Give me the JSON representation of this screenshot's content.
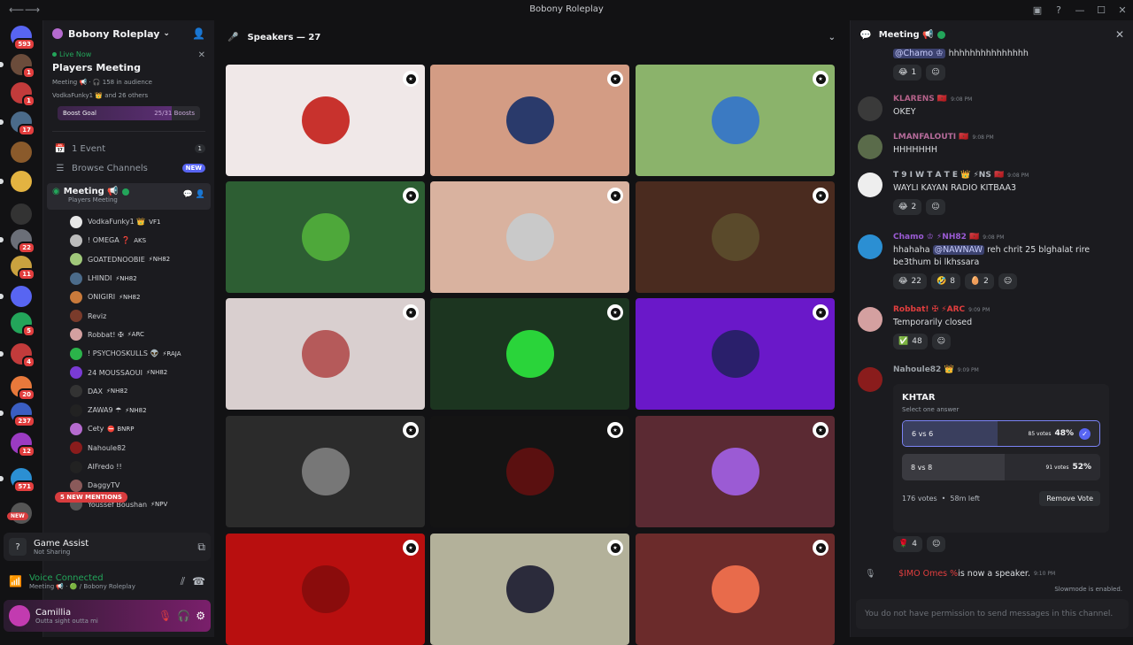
{
  "window": {
    "title": "Bobony Roleplay"
  },
  "guilds": [
    {
      "badge": "593",
      "color": "#5865f2"
    },
    {
      "badge": "1",
      "color": "#6b4c3b"
    },
    {
      "badge": "1",
      "color": "#c23b3b"
    },
    {
      "badge": "17",
      "color": "#4b6b8a"
    },
    {
      "badge": "",
      "color": "#8a5a2b"
    },
    {
      "badge": "",
      "color": "#e3b341"
    },
    {
      "badge": "",
      "color": "#333"
    },
    {
      "badge": "22",
      "color": "#6b6f78"
    },
    {
      "badge": "11",
      "color": "#caa23f"
    },
    {
      "badge": "",
      "color": "#5865f2"
    },
    {
      "badge": "5",
      "color": "#23a55a"
    },
    {
      "badge": "4",
      "color": "#c23b3b"
    },
    {
      "badge": "20",
      "color": "#e8793b"
    },
    {
      "badge": "237",
      "color": "#3a5ec2"
    },
    {
      "badge": "12",
      "color": "#9b3bc2"
    },
    {
      "badge": "571",
      "color": "#2b8fd3"
    },
    {
      "badge": "",
      "color": "#555"
    }
  ],
  "guild_new_label": "NEW",
  "server": {
    "name": "Bobony Roleplay",
    "live_label": "Live Now",
    "live_title": "Players Meeting",
    "live_meta": "Meeting 📢 · 🎧 158 in audience",
    "live_meta2": "VodkaFunky1 👑 and 26 others",
    "boost_label": "Boost Goal",
    "boost_value": "25/31 Boosts",
    "boost_progress": 0.8
  },
  "side_rows": [
    {
      "label": "1 Event",
      "icon": "📅",
      "right": "1"
    },
    {
      "label": "Browse Channels",
      "icon": "☰",
      "right": "NEW"
    }
  ],
  "voice_channel": {
    "name": "Meeting 📢",
    "sub": "Players Meeting"
  },
  "members": [
    {
      "name": "VodkaFunky1 👑",
      "tag": "VF1",
      "color": "#e7e7e7"
    },
    {
      "name": "! OMEGA ❓",
      "tag": "AKS",
      "color": "#bbb"
    },
    {
      "name": "GOATEDNOOBIE",
      "tag": "⚡NH82",
      "color": "#a0c87a"
    },
    {
      "name": "LHINDI",
      "tag": "⚡NH82",
      "color": "#4b6b8a"
    },
    {
      "name": "ONIGIRI",
      "tag": "⚡NH82",
      "color": "#c97a3b"
    },
    {
      "name": "Reviz",
      "tag": "",
      "color": "#7a3b2b"
    },
    {
      "name": "Robbat! ✠",
      "tag": "⚡ARC",
      "color": "#d4a0a0"
    },
    {
      "name": "! PSYCHOSKULLS 👽",
      "tag": "⚡RAJA",
      "color": "#2bb34a"
    },
    {
      "name": "24 MOUSSAOUI",
      "tag": "⚡NH82",
      "color": "#7a3bd4"
    },
    {
      "name": "DAX",
      "tag": "⚡NH82",
      "color": "#333"
    },
    {
      "name": "ZAWA9 ☂",
      "tag": "⚡NH82",
      "color": "#222"
    },
    {
      "name": "Cety",
      "tag": "⛔ BNRP",
      "color": "#b56bcf"
    },
    {
      "name": "Nahoule82",
      "tag": "",
      "color": "#8a1c1c"
    },
    {
      "name": "AlFredo !!",
      "tag": "",
      "color": "#222"
    },
    {
      "name": "DaggyTV",
      "tag": "",
      "color": "#8a5a5a"
    },
    {
      "name": "Youssef Boushan",
      "tag": "⚡NPV",
      "color": "#555"
    }
  ],
  "mentions_label": "5 NEW MENTIONS",
  "game_assist": {
    "title": "Game Assist",
    "sub": "Not Sharing"
  },
  "voice_connected": {
    "title": "Voice Connected",
    "sub": "Meeting 📢 · 🟢 / Bobony Roleplay"
  },
  "user": {
    "name": "Camillia",
    "status": "Outta sight outta mi"
  },
  "stage": {
    "title": "Speakers — 27"
  },
  "tiles": [
    {
      "bg": "#f0e8e8",
      "av": "#c8322d"
    },
    {
      "bg": "#d39c84",
      "av": "#2a3a6b"
    },
    {
      "bg": "#8bb36b",
      "av": "#3b7ac2"
    },
    {
      "bg": "#2d5e33",
      "av": "#4ea83a"
    },
    {
      "bg": "#d9b29f",
      "av": "#c9c9c9"
    },
    {
      "bg": "#4a2b1f",
      "av": "#5a4a2b"
    },
    {
      "bg": "#d9cfcf",
      "av": "#b55a5a"
    },
    {
      "bg": "#1c3520",
      "av": "#2ad43a"
    },
    {
      "bg": "#6a18c9",
      "av": "#2a1f6b"
    },
    {
      "bg": "#2b2b2b",
      "av": "#777777"
    },
    {
      "bg": "#141414",
      "av": "#5a1010"
    },
    {
      "bg": "#5b2a33",
      "av": "#9b5bd4"
    },
    {
      "bg": "#b80f0f",
      "av": "#8a0c0c"
    },
    {
      "bg": "#b3b19a",
      "av": "#2b2b3b"
    },
    {
      "bg": "#6b2b2b",
      "av": "#e86b4b"
    }
  ],
  "chat": {
    "title": "Meeting 📢",
    "messages": [
      {
        "user": "@Chamo ♔",
        "time": "",
        "text": "hhhhhhhhhhhhhhh",
        "color": "#9aa4ff",
        "reacts": [
          {
            "e": "😂",
            "c": "1"
          },
          {
            "e": "☺",
            "c": ""
          }
        ]
      },
      {
        "user": "KLARENS 🇲🇦",
        "time": "9:08 PM",
        "text": "OKEY",
        "color": "#b5628a",
        "reacts": []
      },
      {
        "user": "LMANFALOUTI 🇲🇦",
        "time": "9:08 PM",
        "text": "HHHHHHH",
        "color": "#b56b9a",
        "reacts": []
      },
      {
        "user": "T 9 I W T A T E 👑 ⚡NS 🇲🇦",
        "time": "9:08 PM",
        "text": "WAYLI KAYAN RADIO KITBAA3",
        "color": "#b5bac1",
        "reacts": [
          {
            "e": "😂",
            "c": "2"
          },
          {
            "e": "☺",
            "c": ""
          }
        ]
      },
      {
        "user": "Chamo ♔ ⚡NH82 🇲🇦",
        "time": "9:08 PM",
        "text1": "hhahaha ",
        "mention": "@NAWNAW",
        "text2": " reh chrit 25 blghalat rire be3thum bi lkhssara",
        "color": "#9b5bd4",
        "reacts": [
          {
            "e": "😂",
            "c": "22"
          },
          {
            "e": "🤣",
            "c": "8"
          },
          {
            "e": "🥚",
            "c": "2"
          },
          {
            "e": "☺",
            "c": ""
          }
        ]
      },
      {
        "user": "Robbat! ✠ ⚡ARC",
        "time": "9:09 PM",
        "text": "Temporarily closed",
        "color": "#e23e3e",
        "reacts": [
          {
            "e": "✅",
            "c": "48"
          },
          {
            "e": "☺",
            "c": ""
          }
        ]
      },
      {
        "user": "Nahoule82 👑",
        "time": "9:09 PM",
        "text": "",
        "color": "#9aa0a6",
        "reacts": []
      }
    ],
    "poll": {
      "question": "KHTAR",
      "hint": "Select one answer",
      "options": [
        {
          "label": "6 vs 6",
          "votes": "85 votes",
          "pct": "48%",
          "fraction": 0.48,
          "selected": true
        },
        {
          "label": "8 vs 8",
          "votes": "91 votes",
          "pct": "52%",
          "fraction": 0.52,
          "selected": false
        }
      ],
      "total": "176 votes",
      "left": "58m left",
      "remove": "Remove Vote",
      "react_count": "4"
    },
    "system": {
      "user": "$IMO Omes %",
      "text": " is now a speaker.",
      "time": "9:10 PM"
    },
    "slowmode": "Slowmode is enabled.",
    "input_placeholder": "You do not have permission to send messages in this channel."
  }
}
